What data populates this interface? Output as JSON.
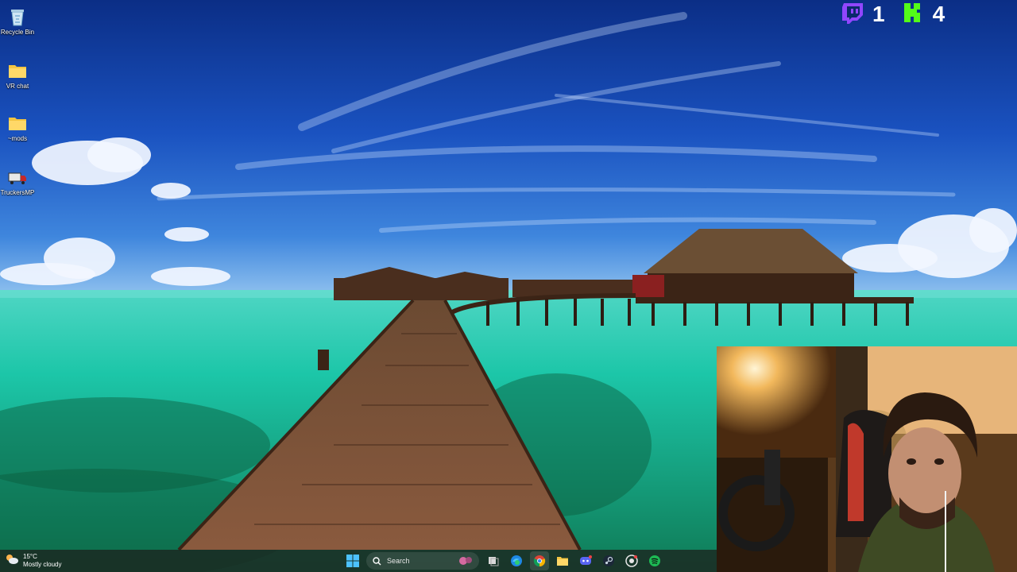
{
  "desktop": {
    "icons": [
      {
        "name": "recycle-bin",
        "label": "Recycle Bin"
      },
      {
        "name": "vr-chat-folder",
        "label": "VR chat"
      },
      {
        "name": "mods-folder",
        "label": "~mods"
      },
      {
        "name": "truckersmp",
        "label": "TruckersMP"
      }
    ]
  },
  "overlay": {
    "twitch_count": "1",
    "kick_count": "4",
    "colors": {
      "twitch": "#9146ff",
      "kick": "#53fc18"
    }
  },
  "taskbar": {
    "weather_temp": "15°C",
    "weather_condition": "Mostly cloudy",
    "search_placeholder": "Search",
    "pinned_apps": [
      "start",
      "search",
      "task-view",
      "edge",
      "chrome",
      "file-explorer",
      "discord",
      "steam",
      "github-desktop",
      "spotify"
    ]
  }
}
